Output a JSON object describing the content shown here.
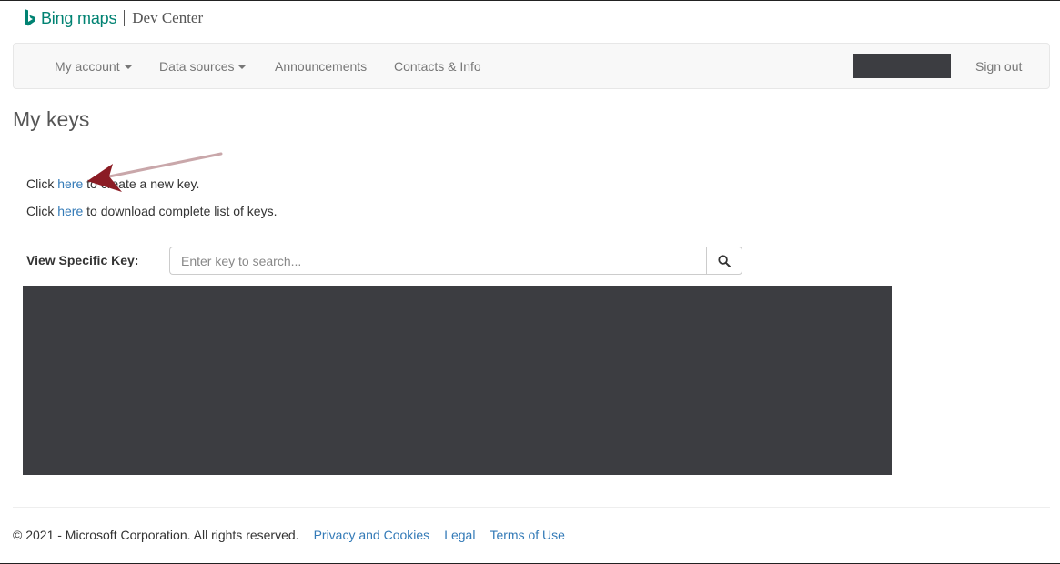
{
  "header": {
    "brand_name": "Bing maps",
    "product_name": "Dev Center",
    "brand_color": "#008272"
  },
  "navbar": {
    "items": [
      {
        "label": "My account",
        "has_dropdown": true
      },
      {
        "label": "Data sources",
        "has_dropdown": true
      },
      {
        "label": "Announcements",
        "has_dropdown": false
      },
      {
        "label": "Contacts & Info",
        "has_dropdown": false
      }
    ],
    "sign_out": "Sign out"
  },
  "page": {
    "title": "My keys",
    "create_line": {
      "prefix": "Click ",
      "link": "here",
      "suffix": " to create a new key."
    },
    "download_line": {
      "prefix": "Click ",
      "link": "here",
      "suffix": " to download complete list of keys."
    }
  },
  "search": {
    "label": "View Specific Key:",
    "placeholder": "Enter key to search...",
    "value": "",
    "button_icon": "search-icon"
  },
  "footer": {
    "copyright": "© 2021 - Microsoft Corporation. All rights reserved.",
    "links": [
      "Privacy and Cookies",
      "Legal",
      "Terms of Use"
    ]
  },
  "colors": {
    "link": "#337ab7",
    "redaction": "#3c3d41",
    "annotation_arrow": "#8b1c24"
  }
}
